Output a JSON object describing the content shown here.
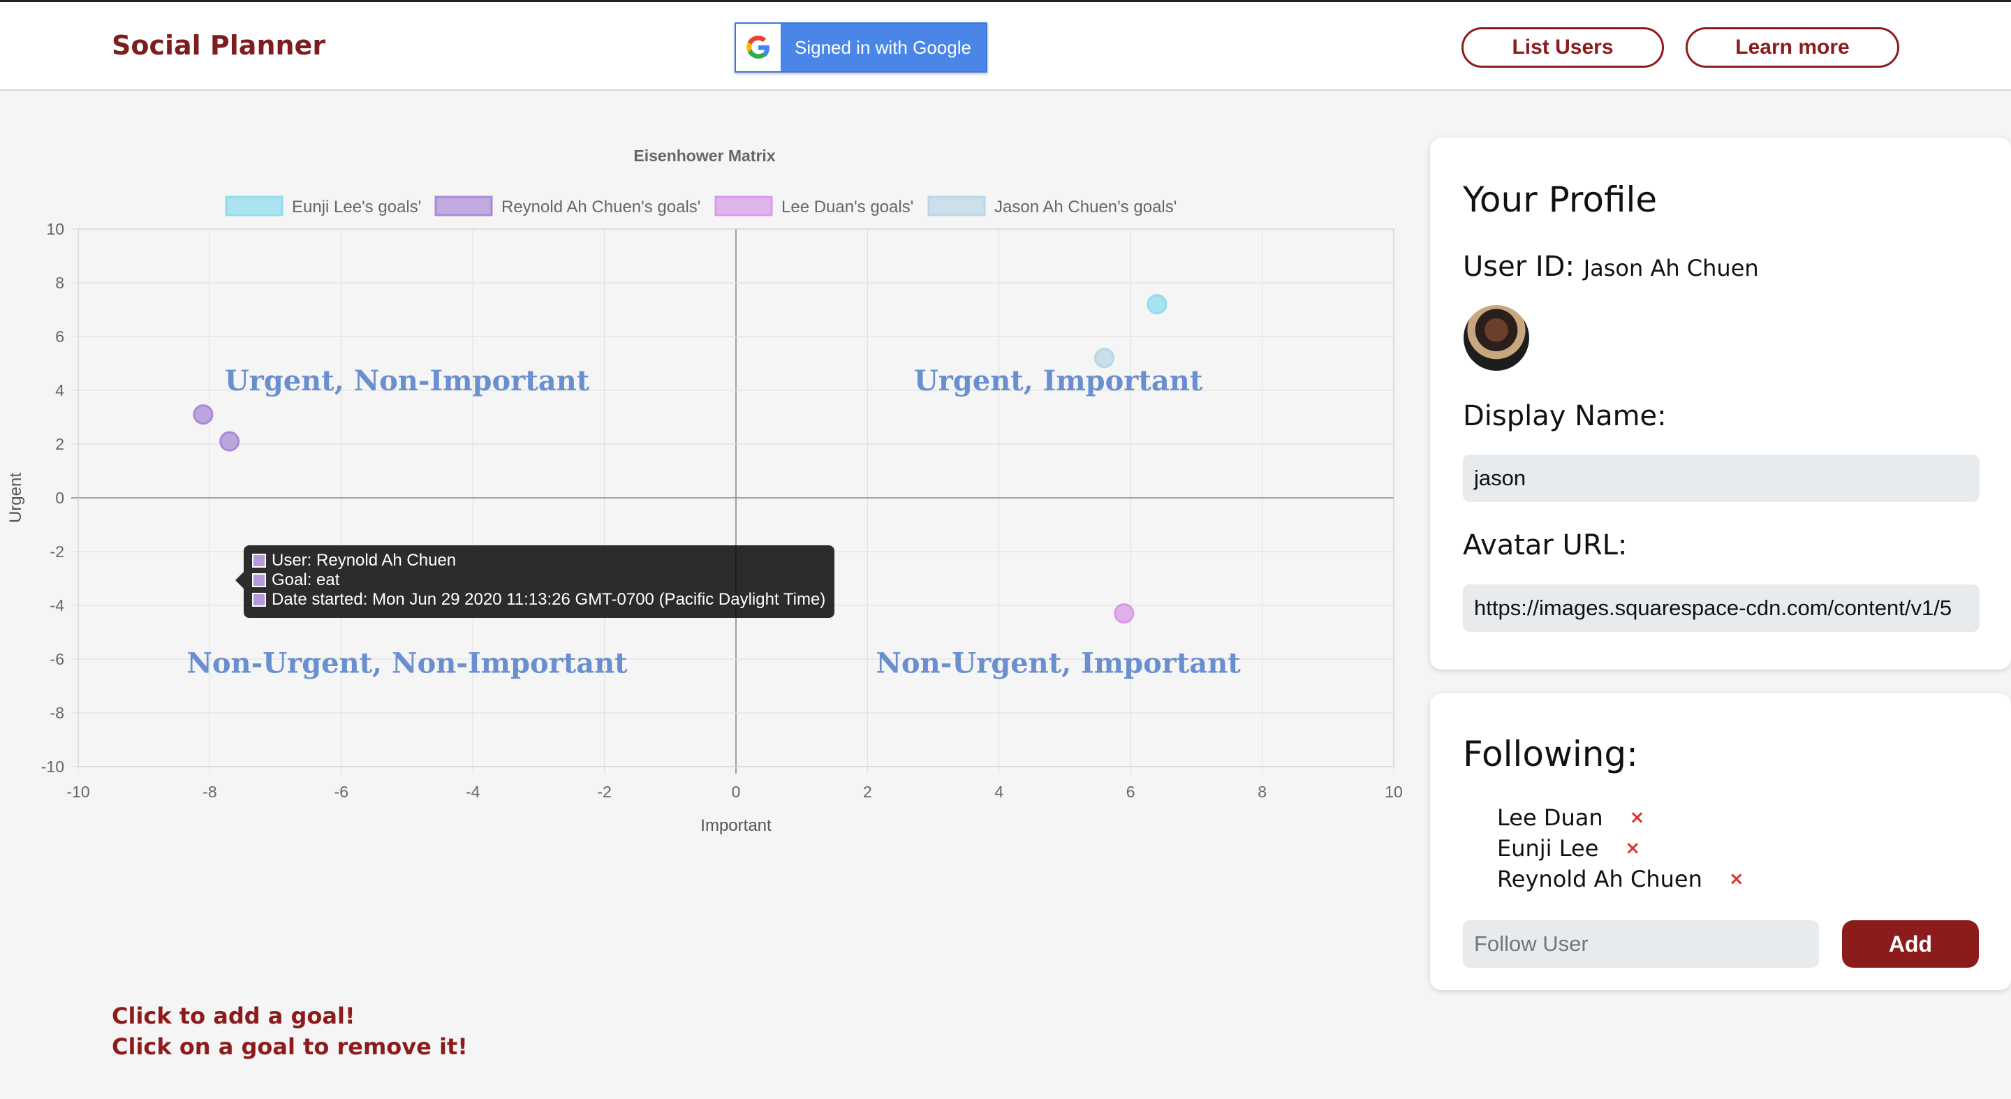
{
  "header": {
    "brand": "Social Planner",
    "google_button_label": "Signed in with Google",
    "list_users_label": "List Users",
    "learn_more_label": "Learn more"
  },
  "chart_data": {
    "type": "scatter",
    "title": "Eisenhower Matrix",
    "xlabel": "Important",
    "ylabel": "Urgent",
    "xlim": [
      -10,
      10
    ],
    "ylim": [
      -10,
      10
    ],
    "x_ticks": [
      -10,
      -8,
      -6,
      -4,
      -2,
      0,
      2,
      4,
      6,
      8,
      10
    ],
    "y_ticks": [
      10,
      8,
      6,
      4,
      2,
      0,
      -2,
      -4,
      -6,
      -8,
      -10
    ],
    "grid": true,
    "legend_position": "top",
    "series": [
      {
        "name": "Eunji Lee's goals'",
        "color": "#8fdcef",
        "points": [
          [
            6.4,
            7.2
          ]
        ]
      },
      {
        "name": "Reynold Ah Chuen's goals'",
        "color": "#a98ad6",
        "points": [
          [
            -8.1,
            3.1
          ],
          [
            -7.7,
            2.1
          ]
        ]
      },
      {
        "name": "Lee Duan's goals'",
        "color": "#d79ae8",
        "points": [
          [
            5.9,
            -4.3
          ]
        ]
      },
      {
        "name": "Jason Ah Chuen's goals'",
        "color": "#b9d7e6",
        "points": [
          [
            5.6,
            5.2
          ]
        ]
      }
    ],
    "quadrant_labels": {
      "top_left": "Urgent, Non-Important",
      "top_right": "Urgent, Important",
      "bottom_left": "Non-Urgent, Non-Important",
      "bottom_right": "Non-Urgent, Important"
    }
  },
  "tooltip": {
    "user": "User: Reynold Ah Chuen",
    "goal": "Goal: eat",
    "date": "Date started: Mon Jun 29 2020 11:13:26 GMT-0700 (Pacific Daylight Time)"
  },
  "hints": {
    "add": "Click to add a goal!",
    "remove": "Click on a goal to remove it!"
  },
  "profile": {
    "title": "Your Profile",
    "user_id_label": "User ID:",
    "user_id_value": "Jason Ah Chuen",
    "display_name_label": "Display Name:",
    "display_name_value": "jason",
    "avatar_url_label": "Avatar URL:",
    "avatar_url_value": "https://images.squarespace-cdn.com/content/v1/5"
  },
  "following": {
    "title": "Following:",
    "users": [
      {
        "name": "Lee Duan"
      },
      {
        "name": "Eunji Lee"
      },
      {
        "name": "Reynold Ah Chuen"
      }
    ],
    "remove_symbol": "×",
    "input_placeholder": "Follow User",
    "add_label": "Add"
  }
}
